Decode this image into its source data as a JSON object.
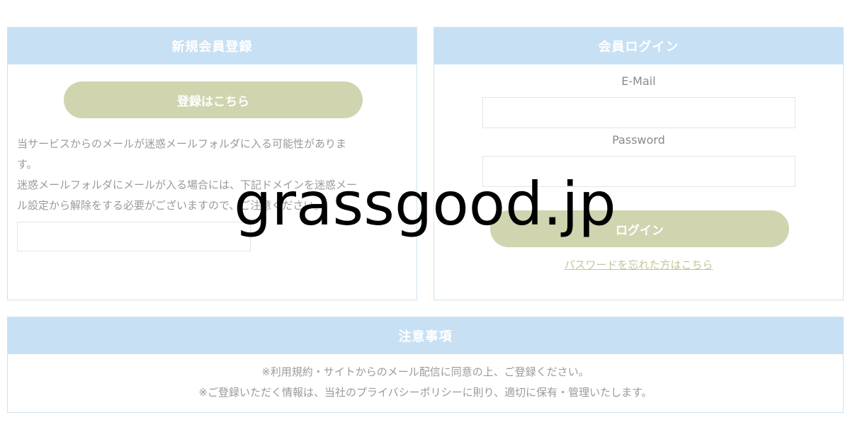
{
  "register": {
    "header": "新規会員登録",
    "button_label": "登録はこちら",
    "notice_line1": "当サービスからのメールが迷惑メールフォルダに入る可能性がありま",
    "notice_line2": "す。",
    "notice_line3": "迷惑メールフォルダにメールが入る場合には、下記ドメインを迷惑メー",
    "notice_line4": "ル設定から解除をする必要がございますので、ご注意ください。"
  },
  "login": {
    "header": "会員ログイン",
    "email_label": "E-Mail",
    "password_label": "Password",
    "button_label": "ログイン",
    "forgot_link": "パスワードを忘れた方はこちら"
  },
  "notes": {
    "header": "注意事項",
    "line1": "※利用規約・サイトからのメール配信に同意の上、ご登録ください。",
    "line2": "※ご登録いただく情報は、当社のプライバシーポリシーに則り、適切に保有・管理いたします。"
  },
  "watermark": {
    "text": "grassgood.jp"
  },
  "colors": {
    "header_bg": "#c8e0f3",
    "button_bg": "#d0d5b0",
    "link": "#c6c49a"
  }
}
